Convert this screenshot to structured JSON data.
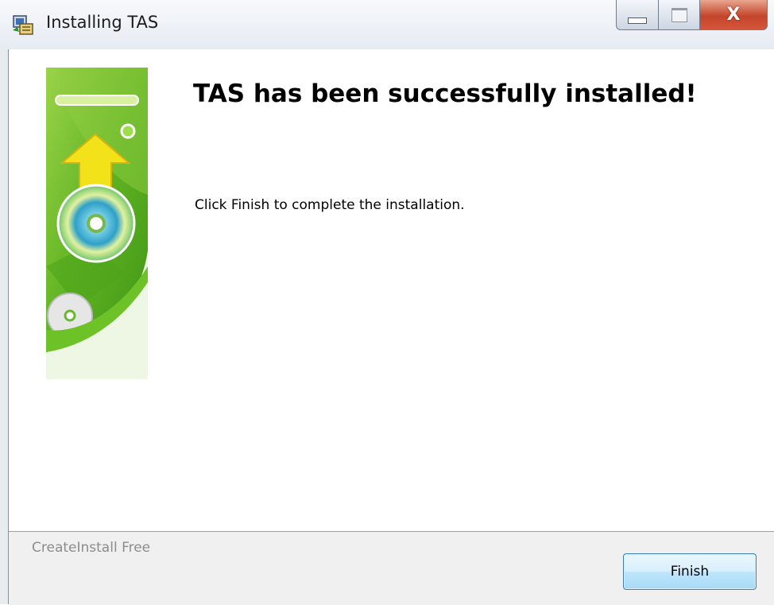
{
  "window": {
    "title": "Installing TAS",
    "icon": "installer-icon",
    "controls": [
      "minimize-icon",
      "maximize-icon",
      "close-icon"
    ]
  },
  "main": {
    "heading": "TAS has been successfully installed!",
    "message": "Click Finish to complete the installation.",
    "banner_image": "installer-banner-cd-icon"
  },
  "footer": {
    "brand": "CreateInstall Free",
    "finish_label": "Finish"
  },
  "colors": {
    "banner_green": "#5cae1e",
    "arrow_yellow": "#f1e21a",
    "button_border": "#3c7fb1",
    "close_red": "#c4452b"
  }
}
